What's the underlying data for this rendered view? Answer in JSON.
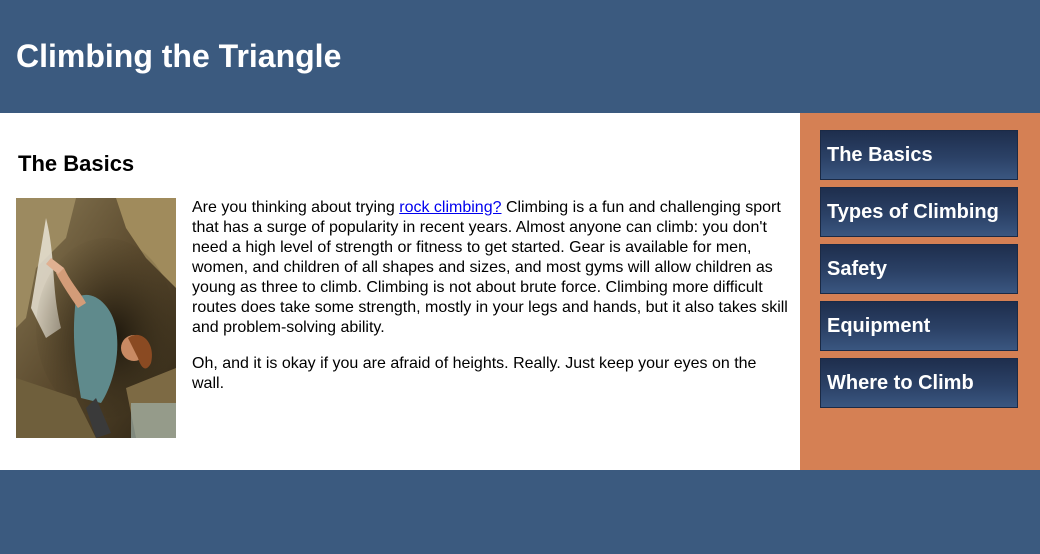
{
  "header": {
    "title": "Climbing the Triangle"
  },
  "main": {
    "heading": "The Basics",
    "paragraph1": {
      "before_link": "Are you thinking about trying ",
      "link_text": "rock climbing?",
      "after_link": " Climbing is a fun and challenging sport that has a surge of popularity in recent years. Almost anyone can climb: you don't need a high level of strength or fitness to get started. Gear is available for men, women, and children of all shapes and sizes, and most gyms will allow children as young as three to climb. Climbing is not about brute force. Climbing more difficult routes does take some strength, mostly in your legs and hands, but it also takes skill and problem-solving ability."
    },
    "paragraph2": "Oh, and it is okay if you are afraid of heights. Really. Just keep your eyes on the wall."
  },
  "sidebar": {
    "items": [
      {
        "label": "The Basics"
      },
      {
        "label": "Types of Climbing"
      },
      {
        "label": "Safety"
      },
      {
        "label": "Equipment"
      },
      {
        "label": "Where to Climb"
      }
    ]
  },
  "colors": {
    "header_bg": "#3b5a7f",
    "sidebar_bg": "#d58054",
    "nav_button_top": "#1e2e4d",
    "nav_button_bottom": "#3a5680",
    "link": "#0000ee"
  }
}
